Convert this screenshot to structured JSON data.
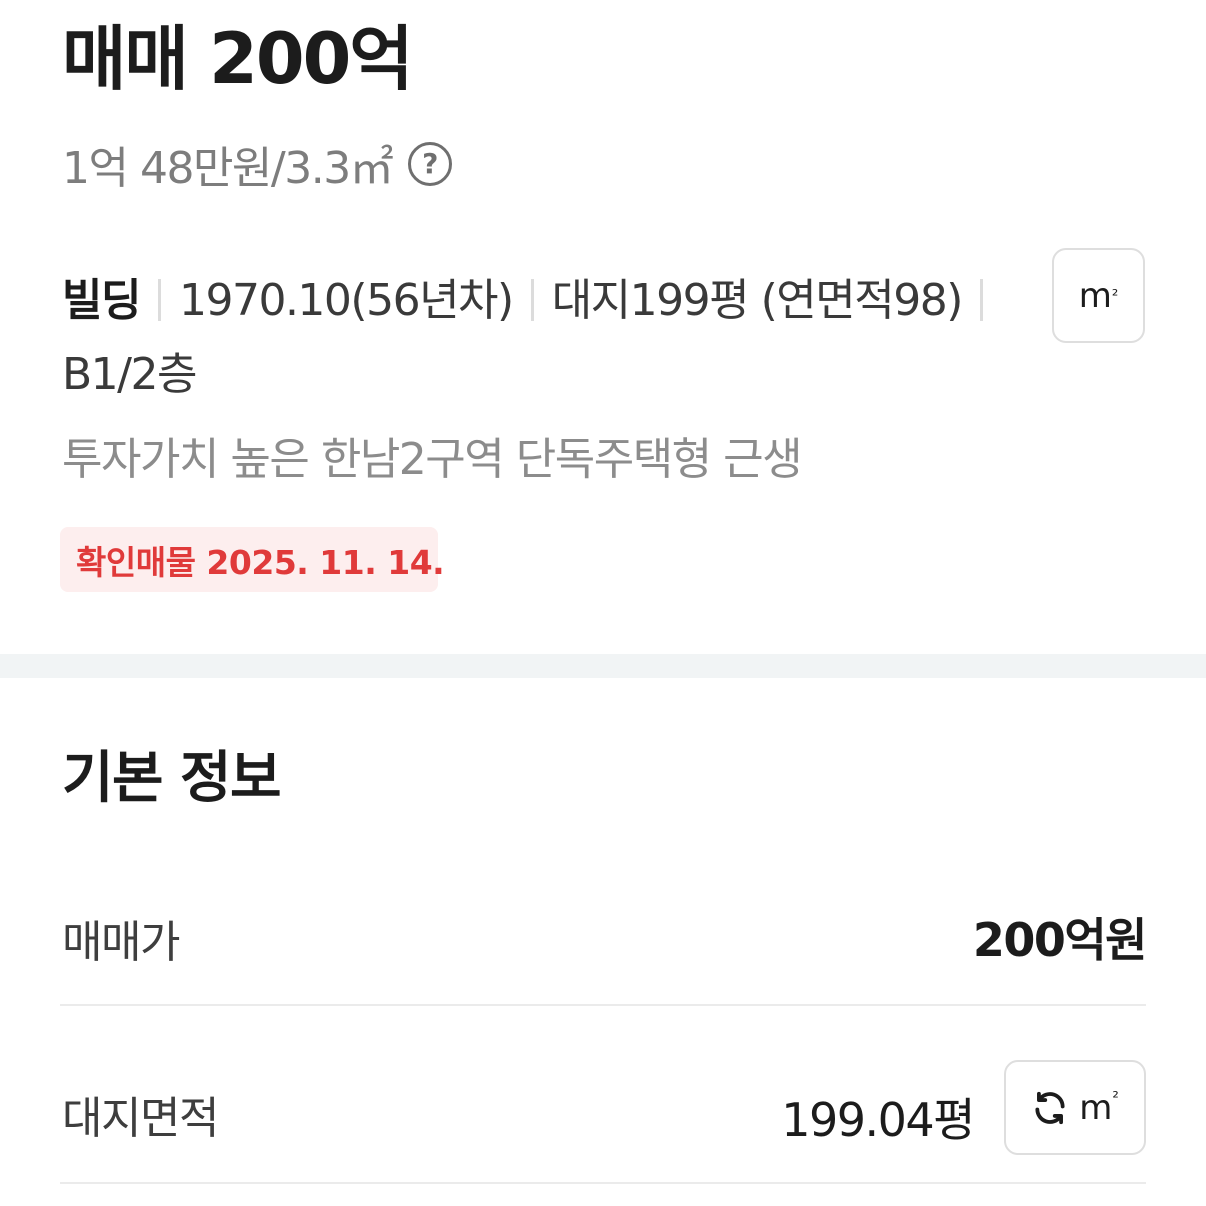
{
  "listing": {
    "price_title": "매매 200억",
    "unit_price": "1억 48만원/3.3㎡",
    "specs": {
      "type": "빌딩",
      "built": "1970.10(56년차)",
      "area": "대지199평 (연면적98)",
      "floor": "B1/2층"
    },
    "unit_toggle": {
      "label": "m",
      "sup": "²"
    },
    "description": "투자가치 높은 한남2구역 단독주택형 근생",
    "verified_badge": "확인매물 2025. 11. 14."
  },
  "basic_info": {
    "title": "기본 정보",
    "rows": [
      {
        "label": "매매가",
        "value": "200억원"
      },
      {
        "label": "대지면적",
        "value": "199.04평",
        "unit_button": {
          "label": "m",
          "sup": "²"
        }
      }
    ]
  },
  "icons": {
    "help": "question-circle-icon",
    "refresh": "refresh-icon"
  },
  "colors": {
    "badge_text": "#e03a3a",
    "badge_bg": "#fdeeee",
    "divider": "#f1f4f5"
  }
}
